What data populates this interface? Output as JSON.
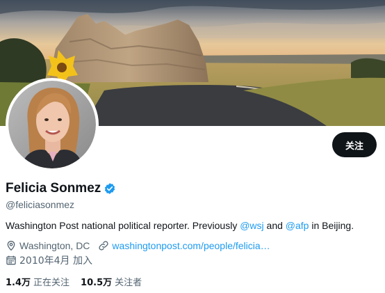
{
  "profile": {
    "name": "Felicia Sonmez",
    "handle": "@feliciasonmez",
    "follow_label": "关注",
    "bio": {
      "text1": "Washington Post national political reporter. Previously ",
      "mention1": "@wsj",
      "text2": " and ",
      "mention2": "@afp",
      "text3": " in Beijing."
    },
    "location": "Washington, DC",
    "website": "washingtonpost.com/people/felicia…",
    "joined": "2010年4月 加入",
    "following_count": "1.4万",
    "following_label": "正在关注",
    "followers_count": "10.5万",
    "followers_label": "关注者"
  },
  "icons": {
    "verified": "verified-badge-icon",
    "location": "location-pin-icon",
    "link": "link-icon",
    "calendar": "calendar-icon"
  },
  "colors": {
    "accent": "#1d9bf0",
    "text": "#0f1419",
    "secondary": "#536471",
    "button": "#0f1419"
  }
}
